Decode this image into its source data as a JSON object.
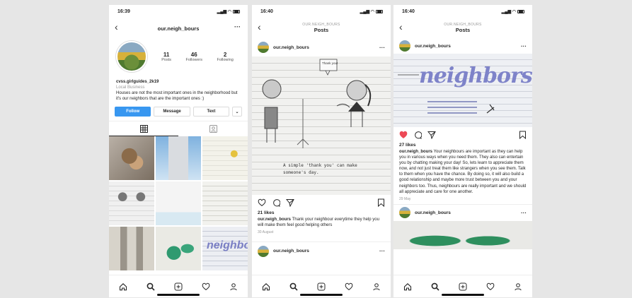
{
  "status": {
    "time1": "16:39",
    "time2": "16:40",
    "time3": "16:40"
  },
  "profile": {
    "username": "our.neigh_bours",
    "posts_count": "11",
    "posts_label": "Posts",
    "followers_count": "46",
    "followers_label": "Followers",
    "following_count": "2",
    "following_label": "Following",
    "name": "cvss.girlguides_2k19",
    "category": "Local Business",
    "bio": "Houses are not the most important ones in the neighborhood but it's our neighbors that are the important ones :)",
    "follow_label": "Follow",
    "message_label": "Message",
    "text_label": "Text"
  },
  "post1": {
    "header_sub": "OUR.NEIGH_BOURS",
    "header_title": "Posts",
    "username": "our.neigh_bours",
    "likes": "21 likes",
    "caption": "Thank your neighbour everytime they help you will make them feel good helping others",
    "date": "30 August",
    "next_username": "our.neigh_bours",
    "image_text_bubble": "Thank you!",
    "image_text_bottom": "A simple 'thank you' can make someone's day."
  },
  "post2": {
    "header_sub": "OUR.NEIGH_BOURS",
    "header_title": "Posts",
    "username": "our.neigh_bours",
    "likes": "27 likes",
    "caption": "Your neighbours are important as they can help you in various ways when you need them. They also can entertain you by chatting making your day! So, lets learn to appreciate them now, and not just treat them like strangers when you see them. Talk to them when you have the chance. By doing so, it will also build a good relationship and maybe more trust between you and your neighbors too. Thus, neighbours are really important and we should all appreciate and care for one another.",
    "date": "29 May",
    "next_username": "our.neigh_bours",
    "image_word": "neighbors",
    "heart_color": "#ed4956"
  }
}
